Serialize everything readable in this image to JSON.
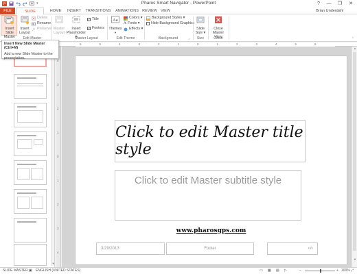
{
  "window": {
    "title": "Pharos Smart Navigator - PowerPoint",
    "user": "Brian Underdahl",
    "controls": [
      "?",
      "—",
      "❐",
      "✕"
    ]
  },
  "tabs": [
    {
      "id": "file",
      "label": "FILE"
    },
    {
      "id": "slide-master",
      "label": "SLIDE MASTER"
    },
    {
      "id": "home",
      "label": "HOME"
    },
    {
      "id": "insert",
      "label": "INSERT"
    },
    {
      "id": "transitions",
      "label": "TRANSITIONS"
    },
    {
      "id": "animations",
      "label": "ANIMATIONS"
    },
    {
      "id": "review",
      "label": "REVIEW"
    },
    {
      "id": "view",
      "label": "VIEW"
    }
  ],
  "ribbon": {
    "insert_slide_master": "Insert Slide Master",
    "insert_layout": "Insert Layout",
    "delete": "Delete",
    "rename": "Rename",
    "preserve": "Preserve",
    "master_layout": "Master Layout",
    "insert_placeholder": "Insert Placeholder ▾",
    "title_check": "Title",
    "footers_check": "Footers",
    "themes": "Themes",
    "colors": "Colors ▾",
    "fonts": "Fonts ▾",
    "effects": "Effects ▾",
    "background_styles": "Background Styles ▾",
    "hide_background": "Hide Background Graphics",
    "slide_size": "Slide Size ▾",
    "close_master_view": "Close Master View",
    "groups": {
      "edit_master": "Edit Master",
      "master_layout": "Master Layout",
      "edit_theme": "Edit Theme",
      "background": "Background",
      "size": "Size",
      "close": "Close"
    }
  },
  "tooltip": {
    "title": "Insert New Slide Master (Ctrl+M)",
    "body": "Add a new Slide Master to the presentation."
  },
  "thumbnails": {
    "master_number": "1",
    "layout_count": 8
  },
  "ruler": {
    "h_ticks": [
      "6",
      "5",
      "4",
      "3",
      "2",
      "1",
      "0",
      "1",
      "2",
      "3",
      "4",
      "5",
      "6"
    ],
    "v_ticks": [
      "4",
      "3",
      "2",
      "1",
      "0",
      "1",
      "2",
      "3",
      "4"
    ]
  },
  "slide": {
    "title": "Click to edit Master title style",
    "subtitle": "Click to edit Master subtitle style",
    "url": "www.pharosgps.com",
    "date": "3/29/2013",
    "footer": "Footer",
    "page_number": "‹#›"
  },
  "statusbar": {
    "view": "SLIDE MASTER",
    "language": "ENGLISH (UNITED STATES)",
    "zoom": "100%"
  },
  "colors": {
    "accent": "#d24726",
    "ribbon_bg": "#ffffff",
    "canvas_bg": "#d4d4d4"
  }
}
